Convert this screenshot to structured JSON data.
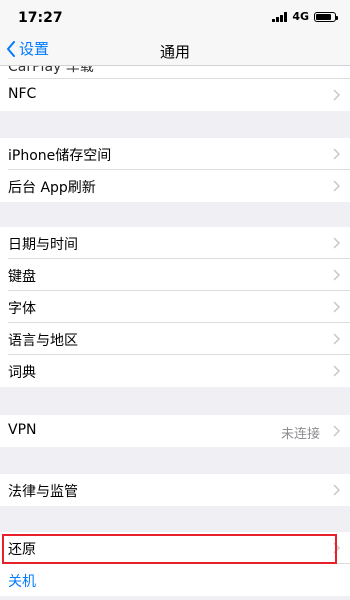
{
  "status_bar": {
    "time": "17:27",
    "network": "4G"
  },
  "nav": {
    "back_label": "设置",
    "title": "通用"
  },
  "groups": [
    {
      "rows": [
        {
          "label": "CarPlay 车载"
        },
        {
          "label": "NFC"
        }
      ]
    },
    {
      "rows": [
        {
          "label": "iPhone储存空间"
        },
        {
          "label": "后台 App刷新"
        }
      ]
    },
    {
      "rows": [
        {
          "label": "日期与时间"
        },
        {
          "label": "键盘"
        },
        {
          "label": "字体"
        },
        {
          "label": "语言与地区"
        },
        {
          "label": "词典"
        }
      ]
    },
    {
      "rows": [
        {
          "label": "VPN",
          "value": "未连接"
        }
      ]
    },
    {
      "rows": [
        {
          "label": "法律与监管"
        }
      ]
    },
    {
      "rows": [
        {
          "label": "还原"
        },
        {
          "label": "关机"
        }
      ]
    }
  ],
  "colors": {
    "accent": "#007aff",
    "highlight": "#e8202a",
    "background": "#efeff4"
  }
}
